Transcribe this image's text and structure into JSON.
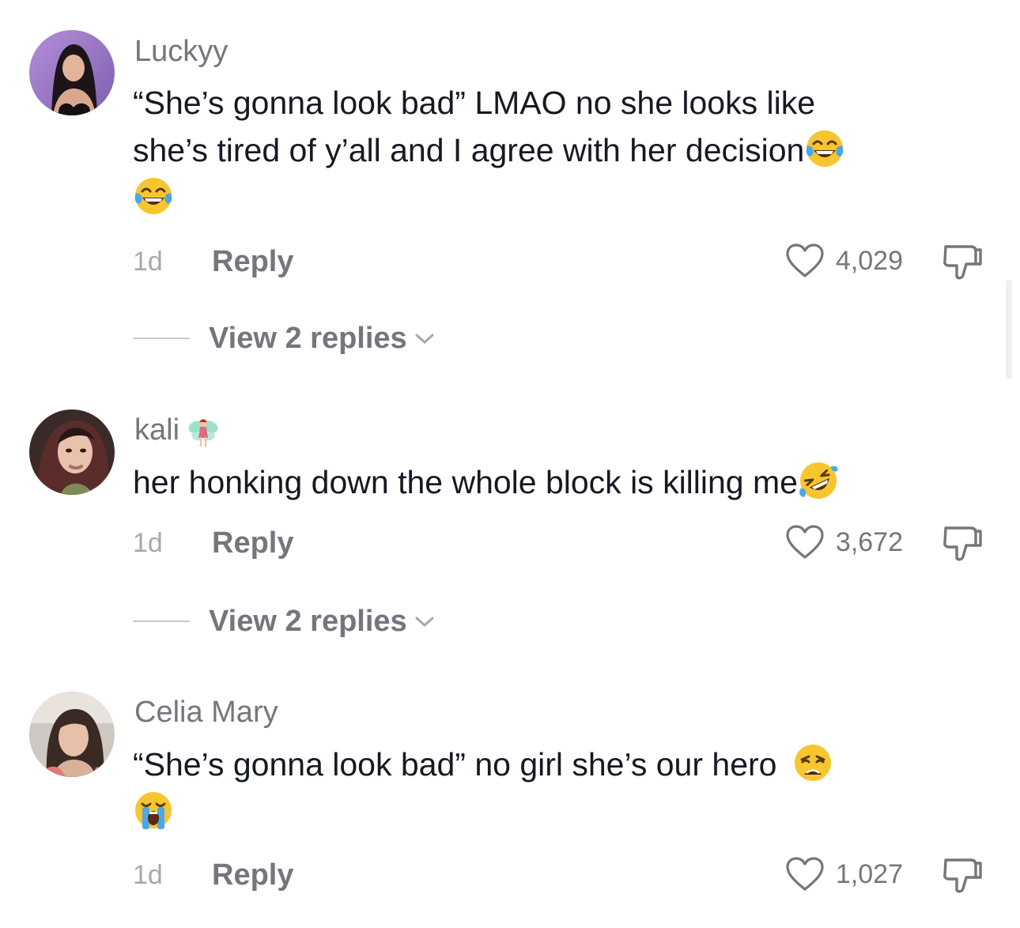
{
  "comments": [
    {
      "username": "Luckyy",
      "text_lines": [
        "“She’s gonna look bad” LMAO no she looks like",
        "she’s tired of y’all and I agree with her decision"
      ],
      "emojis": [
        "face-with-tears-of-joy",
        "face-with-tears-of-joy"
      ],
      "time": "1d",
      "reply_label": "Reply",
      "likes": "4,029",
      "view_replies": "View 2 replies"
    },
    {
      "username": "kali",
      "badge": "fairy",
      "text_lines": [
        "her honking down the whole block is killing me"
      ],
      "emojis": [
        "rolling-on-the-floor-laughing"
      ],
      "time": "1d",
      "reply_label": "Reply",
      "likes": "3,672",
      "view_replies": "View 2 replies"
    },
    {
      "username": "Celia Mary",
      "text_lines": [
        "“She’s gonna look bad” no girl she’s our hero"
      ],
      "emojis": [
        "weary-face",
        "loudly-crying-face"
      ],
      "time": "1d",
      "reply_label": "Reply",
      "likes": "1,027"
    }
  ],
  "colors": {
    "text_primary": "#161823",
    "text_secondary": "#75767d",
    "text_tertiary": "#a7a8ad",
    "emoji_yellow": "#f7c62f",
    "tear_blue": "#4aa8e8"
  }
}
